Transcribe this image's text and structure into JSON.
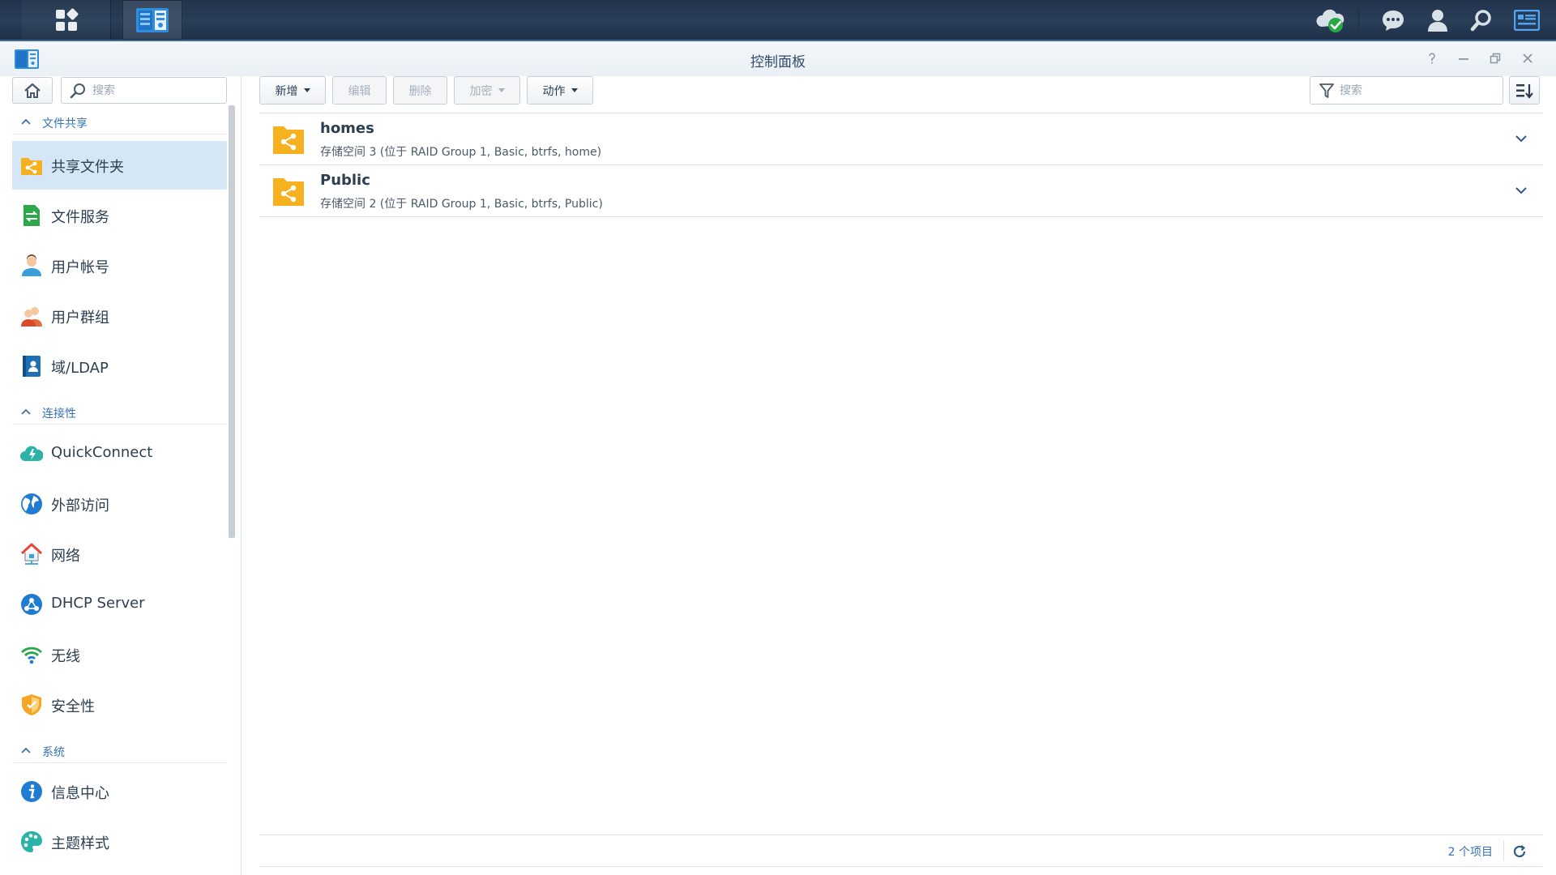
{
  "window": {
    "title": "控制面板"
  },
  "sidebar": {
    "search_placeholder": "搜索",
    "groups": [
      {
        "label": "文件共享"
      },
      {
        "label": "连接性"
      },
      {
        "label": "系统"
      }
    ],
    "items": [
      {
        "label": "共享文件夹",
        "icon": "shared-folder-icon",
        "active": true
      },
      {
        "label": "文件服务",
        "icon": "file-services-icon"
      },
      {
        "label": "用户帐号",
        "icon": "user-account-icon"
      },
      {
        "label": "用户群组",
        "icon": "user-group-icon"
      },
      {
        "label": "域/LDAP",
        "icon": "domain-ldap-icon"
      },
      {
        "label": "QuickConnect",
        "icon": "quickconnect-icon"
      },
      {
        "label": "外部访问",
        "icon": "external-access-icon"
      },
      {
        "label": "网络",
        "icon": "network-icon"
      },
      {
        "label": "DHCP Server",
        "icon": "dhcp-server-icon"
      },
      {
        "label": "无线",
        "icon": "wireless-icon"
      },
      {
        "label": "安全性",
        "icon": "security-icon"
      },
      {
        "label": "信息中心",
        "icon": "info-center-icon"
      },
      {
        "label": "主题样式",
        "icon": "theme-icon"
      }
    ]
  },
  "toolbar": {
    "create_label": "新增",
    "edit_label": "编辑",
    "delete_label": "删除",
    "encrypt_label": "加密",
    "action_label": "动作",
    "filter_placeholder": "搜索"
  },
  "folders": [
    {
      "name": "homes",
      "description": "存储空间 3 (位于 RAID Group 1, Basic, btrfs, home)"
    },
    {
      "name": "Public",
      "description": "存储空间 2 (位于 RAID Group 1, Basic, btrfs, Public)"
    }
  ],
  "footer": {
    "count_text": "2 个项目"
  },
  "colors": {
    "accent": "#3772b3",
    "folder": "#f7b11e",
    "active_bg": "#d5e6f7",
    "taskbar": "#263a52"
  }
}
